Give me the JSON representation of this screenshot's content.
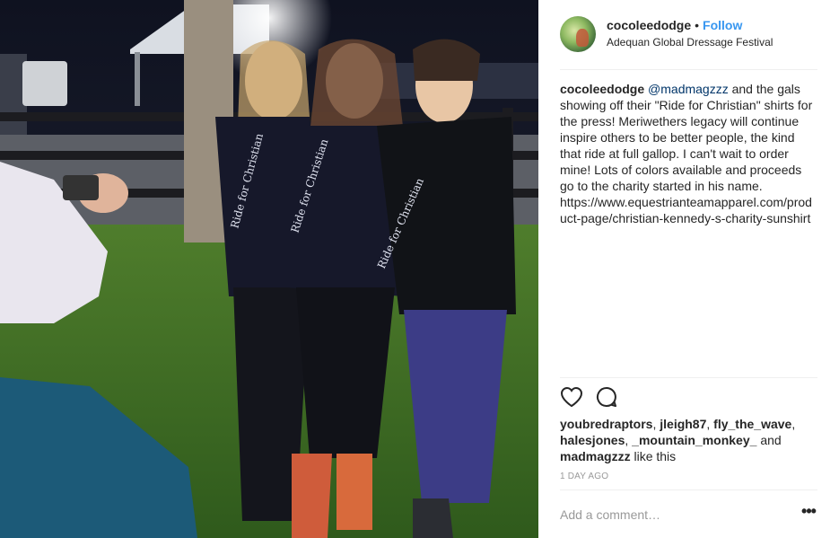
{
  "post": {
    "username": "cocoleedodge",
    "separator": "•",
    "follow_label": "Follow",
    "location": "Adequan Global Dressage Festival"
  },
  "caption": {
    "username": "cocoleedodge",
    "mention": "@madmagzzz",
    "text": "and the gals showing off their \"Ride for Christian\" shirts for the press! Meriwethers legacy will continue inspire others to be better people, the kind that ride at full gallop. I can't wait to order mine! Lots of colors available and proceeds go to the charity started in his name. https://www.equestrianteamapparel.com/product-page/christian-kennedy-s-charity-sunshirt"
  },
  "likes": {
    "users": [
      "youbredraptors",
      "jleigh87",
      "fly_the_wave",
      "halesjones",
      "_mountain_monkey_",
      "madmagzzz"
    ],
    "and_label": "and",
    "suffix": "like this"
  },
  "timestamp": "1 day ago",
  "comment": {
    "placeholder": "Add a comment…"
  },
  "photo": {
    "sleeve_text": "Ride for Christian",
    "icons": {
      "like": "heart-icon",
      "comment": "comment-bubble-icon",
      "more": "more-options-icon"
    }
  },
  "colors": {
    "accent": "#3897f0",
    "text": "#262626",
    "muted": "#999999",
    "divider": "#efefef"
  }
}
